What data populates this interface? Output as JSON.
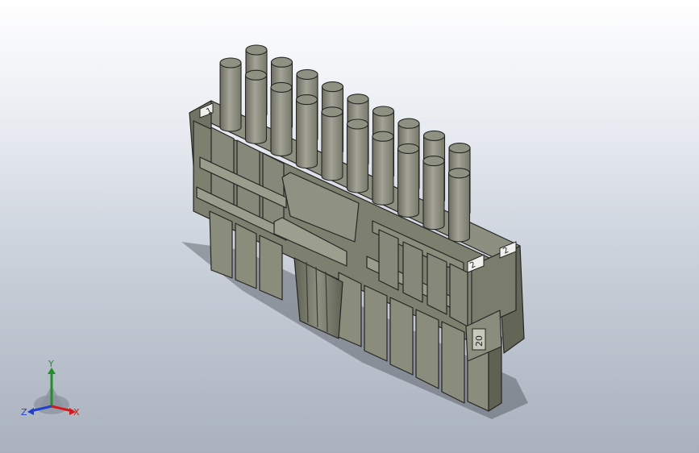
{
  "colors": {
    "body_light": "#8d8f80",
    "body_mid": "#7a7c6c",
    "body_dark": "#5f6152",
    "edge": "#262624",
    "pin_light": "#a3a497",
    "pin_dark": "#6c6d60",
    "axis_x": "#d4191c",
    "axis_y": "#1f8f2a",
    "axis_z": "#1e3fd0"
  },
  "model": {
    "pin_label_top": "1",
    "pin_label_end": "2",
    "pin_label_end_alt": "2",
    "position_label": "20"
  },
  "triad": {
    "x_label": "X",
    "y_label": "Y",
    "z_label": "Z",
    "icon": "coordinate-triad-icon"
  }
}
